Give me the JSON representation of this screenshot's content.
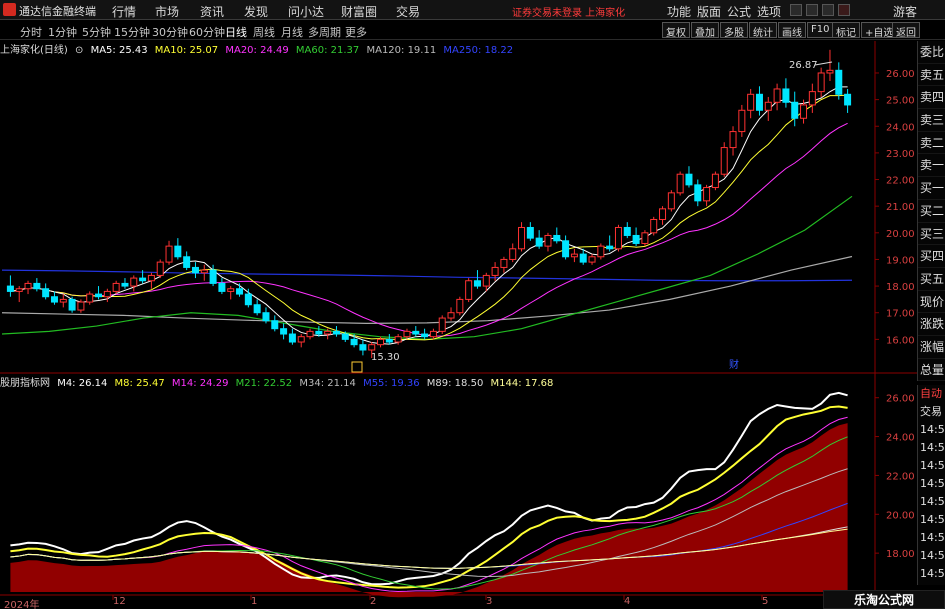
{
  "app": {
    "title": "通达信金融终端",
    "menu": [
      "行情",
      "市场",
      "资讯",
      "发现",
      "问小达",
      "财富圈",
      "交易"
    ],
    "warning": "证券交易未登录  上海家化",
    "right_menu": [
      "功能",
      "版面",
      "公式",
      "选项"
    ],
    "guest": "游客"
  },
  "periods": {
    "items": [
      "分时",
      "1分钟",
      "5分钟",
      "15分钟",
      "30分钟",
      "60分钟",
      "日线",
      "周线",
      "月线",
      "多周期",
      "更多"
    ],
    "active": "日线"
  },
  "toolbar": {
    "items": [
      "复权",
      "叠加",
      "多股",
      "统计",
      "画线",
      "F10",
      "标记",
      "+自选",
      "返回"
    ]
  },
  "main_info": {
    "name": "上海家化(日线)",
    "ma5": "MA5: 25.43",
    "ma10": "MA10: 25.07",
    "ma20": "MA20: 24.49",
    "ma60": "MA60: 21.37",
    "ma120": "MA120: 19.11",
    "ma250": "MA250: 18.22",
    "colors": {
      "ma5": "#ffffff",
      "ma10": "#ffff33",
      "ma20": "#ff33ff",
      "ma60": "#33cc33",
      "ma120": "#bbbbbb",
      "ma250": "#3344ff"
    }
  },
  "main_axis": [
    "26.00",
    "25.00",
    "24.00",
    "23.00",
    "22.00",
    "21.00",
    "20.00",
    "19.00",
    "18.00",
    "17.00",
    "16.00"
  ],
  "annotations": {
    "high": "26.87",
    "low": "15.30",
    "fin_marker": "财"
  },
  "right_panel": {
    "items": [
      "委比",
      "卖五",
      "卖四",
      "卖三",
      "卖二",
      "卖一",
      "买一",
      "买二",
      "买三",
      "买四",
      "买五",
      "现价",
      "涨跌",
      "涨幅",
      "总量",
      "外盘",
      "换手",
      "净资",
      "收益"
    ]
  },
  "right_panel2": {
    "items": [
      "自动",
      "交易",
      "14:56",
      "14:56",
      "14:56",
      "14:56",
      "14:56",
      "14:56",
      "14:56",
      "14:56",
      "14:56"
    ]
  },
  "sub_info": {
    "name": "股朋指标网",
    "m4": "M4: 26.14",
    "m8": "M8: 25.47",
    "m14": "M14: 24.29",
    "m21": "M21: 22.52",
    "m34": "M34: 21.14",
    "m55": "M55: 19.36",
    "m89": "M89: 18.50",
    "m144": "M144: 17.68",
    "colors": {
      "m4": "#ffffff",
      "m8": "#ffff33",
      "m14": "#ff33ff",
      "m21": "#33cc33",
      "m34": "#bbbbbb",
      "m55": "#3344ff",
      "m89": "#dddddd",
      "m144": "#ffff99"
    }
  },
  "sub_axis": [
    "26.00",
    "24.00",
    "22.00",
    "20.00",
    "18.00"
  ],
  "dates": [
    "2024年",
    "12",
    "1",
    "2",
    "3",
    "4",
    "5"
  ],
  "watermark": "乐淘公式网 www.60lt.com",
  "chart_data": {
    "type": "candlestick",
    "ylim": [
      15.3,
      26.87
    ],
    "candles": [
      [
        18.0,
        18.4,
        17.6,
        17.8
      ],
      [
        17.8,
        18.0,
        17.4,
        17.9
      ],
      [
        17.9,
        18.2,
        17.7,
        18.1
      ],
      [
        18.1,
        18.3,
        17.8,
        17.9
      ],
      [
        17.9,
        18.1,
        17.5,
        17.6
      ],
      [
        17.6,
        17.8,
        17.3,
        17.4
      ],
      [
        17.4,
        17.7,
        17.2,
        17.5
      ],
      [
        17.5,
        17.6,
        17.0,
        17.1
      ],
      [
        17.1,
        17.5,
        17.0,
        17.4
      ],
      [
        17.4,
        17.8,
        17.3,
        17.7
      ],
      [
        17.7,
        18.0,
        17.5,
        17.6
      ],
      [
        17.6,
        17.9,
        17.4,
        17.8
      ],
      [
        17.8,
        18.2,
        17.7,
        18.1
      ],
      [
        18.1,
        18.3,
        17.9,
        18.0
      ],
      [
        18.0,
        18.4,
        17.8,
        18.3
      ],
      [
        18.3,
        18.6,
        18.1,
        18.2
      ],
      [
        18.2,
        18.5,
        17.9,
        18.4
      ],
      [
        18.4,
        19.0,
        18.3,
        18.9
      ],
      [
        18.9,
        19.7,
        18.8,
        19.5
      ],
      [
        19.5,
        19.8,
        19.0,
        19.1
      ],
      [
        19.1,
        19.3,
        18.6,
        18.7
      ],
      [
        18.7,
        18.9,
        18.3,
        18.5
      ],
      [
        18.5,
        18.8,
        18.2,
        18.6
      ],
      [
        18.6,
        18.8,
        18.0,
        18.1
      ],
      [
        18.1,
        18.3,
        17.7,
        17.8
      ],
      [
        17.8,
        18.0,
        17.5,
        17.9
      ],
      [
        17.9,
        18.1,
        17.6,
        17.7
      ],
      [
        17.7,
        17.9,
        17.2,
        17.3
      ],
      [
        17.3,
        17.5,
        16.9,
        17.0
      ],
      [
        17.0,
        17.2,
        16.6,
        16.7
      ],
      [
        16.7,
        16.9,
        16.3,
        16.4
      ],
      [
        16.4,
        16.6,
        16.0,
        16.2
      ],
      [
        16.2,
        16.4,
        15.8,
        15.9
      ],
      [
        15.9,
        16.2,
        15.7,
        16.1
      ],
      [
        16.1,
        16.4,
        16.0,
        16.3
      ],
      [
        16.3,
        16.5,
        16.1,
        16.2
      ],
      [
        16.2,
        16.4,
        16.0,
        16.3
      ],
      [
        16.3,
        16.5,
        16.1,
        16.2
      ],
      [
        16.2,
        16.3,
        15.9,
        16.0
      ],
      [
        16.0,
        16.2,
        15.7,
        15.8
      ],
      [
        15.8,
        16.0,
        15.4,
        15.6
      ],
      [
        15.6,
        15.9,
        15.3,
        15.8
      ],
      [
        15.8,
        16.1,
        15.7,
        16.0
      ],
      [
        16.0,
        16.2,
        15.8,
        15.9
      ],
      [
        15.9,
        16.2,
        15.8,
        16.1
      ],
      [
        16.1,
        16.4,
        16.0,
        16.3
      ],
      [
        16.3,
        16.5,
        16.1,
        16.2
      ],
      [
        16.2,
        16.4,
        16.0,
        16.1
      ],
      [
        16.1,
        16.4,
        16.0,
        16.3
      ],
      [
        16.3,
        16.9,
        16.2,
        16.8
      ],
      [
        16.8,
        17.2,
        16.7,
        17.0
      ],
      [
        17.0,
        17.6,
        16.9,
        17.5
      ],
      [
        17.5,
        18.3,
        17.4,
        18.2
      ],
      [
        18.2,
        18.6,
        17.9,
        18.0
      ],
      [
        18.0,
        18.5,
        17.8,
        18.4
      ],
      [
        18.4,
        18.9,
        18.2,
        18.7
      ],
      [
        18.7,
        19.1,
        18.5,
        19.0
      ],
      [
        19.0,
        19.6,
        18.9,
        19.4
      ],
      [
        19.4,
        20.4,
        19.3,
        20.2
      ],
      [
        20.2,
        20.4,
        19.7,
        19.8
      ],
      [
        19.8,
        20.1,
        19.4,
        19.5
      ],
      [
        19.5,
        20.0,
        19.3,
        19.9
      ],
      [
        19.9,
        20.2,
        19.6,
        19.7
      ],
      [
        19.7,
        19.9,
        19.0,
        19.1
      ],
      [
        19.1,
        19.4,
        18.9,
        19.2
      ],
      [
        19.2,
        19.4,
        18.8,
        18.9
      ],
      [
        18.9,
        19.2,
        18.8,
        19.1
      ],
      [
        19.1,
        19.6,
        19.0,
        19.5
      ],
      [
        19.5,
        19.9,
        19.3,
        19.4
      ],
      [
        19.4,
        20.3,
        19.3,
        20.2
      ],
      [
        20.2,
        20.4,
        19.8,
        19.9
      ],
      [
        19.9,
        20.2,
        19.5,
        19.6
      ],
      [
        19.6,
        20.1,
        19.5,
        20.0
      ],
      [
        20.0,
        20.6,
        19.9,
        20.5
      ],
      [
        20.5,
        21.0,
        20.3,
        20.9
      ],
      [
        20.9,
        21.6,
        20.8,
        21.5
      ],
      [
        21.5,
        22.3,
        21.4,
        22.2
      ],
      [
        22.2,
        22.5,
        21.7,
        21.8
      ],
      [
        21.8,
        22.0,
        21.0,
        21.2
      ],
      [
        21.2,
        21.8,
        21.0,
        21.7
      ],
      [
        21.7,
        22.3,
        21.6,
        22.2
      ],
      [
        22.2,
        23.4,
        22.1,
        23.2
      ],
      [
        23.2,
        24.0,
        22.9,
        23.8
      ],
      [
        23.8,
        24.8,
        23.6,
        24.6
      ],
      [
        24.6,
        25.4,
        24.3,
        25.2
      ],
      [
        25.2,
        25.5,
        24.4,
        24.6
      ],
      [
        24.6,
        25.1,
        24.2,
        24.9
      ],
      [
        24.9,
        25.6,
        24.6,
        25.4
      ],
      [
        25.4,
        25.8,
        24.7,
        24.9
      ],
      [
        24.9,
        25.3,
        24.0,
        24.3
      ],
      [
        24.3,
        25.0,
        24.1,
        24.8
      ],
      [
        24.8,
        25.6,
        24.5,
        25.3
      ],
      [
        25.3,
        26.2,
        25.1,
        26.0
      ],
      [
        26.0,
        26.87,
        25.7,
        26.1
      ],
      [
        26.1,
        26.4,
        25.0,
        25.2
      ],
      [
        25.2,
        25.4,
        24.5,
        24.8
      ]
    ],
    "ma250": [
      18.6,
      18.57,
      18.53,
      18.48,
      18.45,
      18.42,
      18.38,
      18.33,
      18.3,
      18.26,
      18.22,
      18.2,
      18.2,
      18.22
    ],
    "ma120": [
      17.0,
      16.95,
      16.9,
      16.8,
      16.72,
      16.65,
      16.6,
      16.62,
      16.7,
      16.88,
      17.1,
      17.5,
      18.0,
      18.6,
      19.11
    ],
    "ma60": [
      16.2,
      16.3,
      16.5,
      16.8,
      17.0,
      16.9,
      16.6,
      16.3,
      16.1,
      16.0,
      16.1,
      16.4,
      16.9,
      17.4,
      17.9,
      18.4,
      19.2,
      20.1,
      21.37
    ],
    "sub_ylim": [
      16.0,
      26.5
    ],
    "m4_end": 26.14,
    "m8_end": 25.47,
    "m14_end": 24.29,
    "m21_end": 22.52,
    "m34_end": 21.14,
    "m55_end": 19.36,
    "m89_end": 18.5,
    "m144_end": 17.68
  }
}
